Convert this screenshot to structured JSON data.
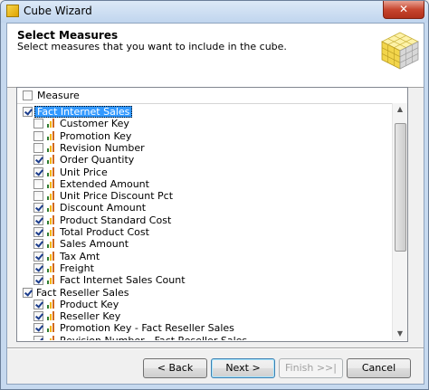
{
  "window": {
    "title": "Cube Wizard",
    "close_glyph": "✕"
  },
  "header": {
    "title": "Select Measures",
    "description": "Select measures that you want to include in the cube."
  },
  "tree": {
    "column_header": "Measure",
    "column_checked": false,
    "rows": [
      {
        "label": "Fact Internet Sales",
        "group": true,
        "checked": true,
        "selected": true
      },
      {
        "label": "Customer Key",
        "checked": false
      },
      {
        "label": "Promotion Key",
        "checked": false
      },
      {
        "label": "Revision Number",
        "checked": false
      },
      {
        "label": "Order Quantity",
        "checked": true
      },
      {
        "label": "Unit Price",
        "checked": true
      },
      {
        "label": "Extended Amount",
        "checked": false
      },
      {
        "label": "Unit Price Discount Pct",
        "checked": false
      },
      {
        "label": "Discount Amount",
        "checked": true
      },
      {
        "label": "Product Standard Cost",
        "checked": true
      },
      {
        "label": "Total Product Cost",
        "checked": true
      },
      {
        "label": "Sales Amount",
        "checked": true
      },
      {
        "label": "Tax Amt",
        "checked": true
      },
      {
        "label": "Freight",
        "checked": true
      },
      {
        "label": "Fact Internet Sales Count",
        "checked": true
      },
      {
        "label": "Fact Reseller Sales",
        "group": true,
        "checked": true,
        "selected": false
      },
      {
        "label": "Product Key",
        "checked": true
      },
      {
        "label": "Reseller Key",
        "checked": true
      },
      {
        "label": "Promotion Key - Fact Reseller Sales",
        "checked": true
      },
      {
        "label": "Revision Number - Fact Reseller Sales",
        "checked": true
      }
    ]
  },
  "buttons": {
    "back": "< Back",
    "next": "Next >",
    "finish": "Finish >>|",
    "cancel": "Cancel"
  },
  "colors": {
    "selection": "#3399ff",
    "measure_bar_1": "#2f7d32",
    "measure_bar_2": "#f4b400",
    "measure_bar_3": "#d2691e"
  }
}
